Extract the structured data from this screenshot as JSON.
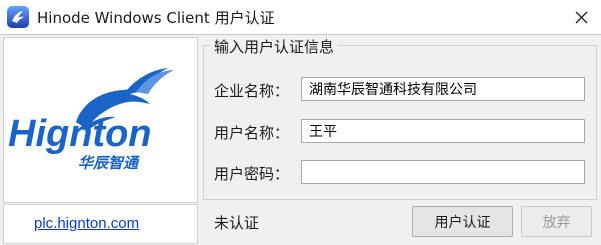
{
  "window": {
    "title": "Hinode Windows Client 用户认证",
    "icon": "app-logo-icon",
    "close_icon": "close-icon"
  },
  "logo": {
    "icon": "hignton-logo",
    "wordmark": "Hignton",
    "chinese_name": "华辰智通",
    "brand_color": "#1a64c8"
  },
  "link": {
    "text": "plc.hignton.com"
  },
  "group": {
    "title": "输入用户认证信息"
  },
  "fields": {
    "company": {
      "label": "企业名称：",
      "value": "湖南华辰智通科技有限公司"
    },
    "username": {
      "label": "用户名称：",
      "value": "王平"
    },
    "password": {
      "label": "用户密码：",
      "value": ""
    }
  },
  "status": {
    "text": "未认证"
  },
  "buttons": {
    "auth": "用户认证",
    "quit": "放弃"
  }
}
